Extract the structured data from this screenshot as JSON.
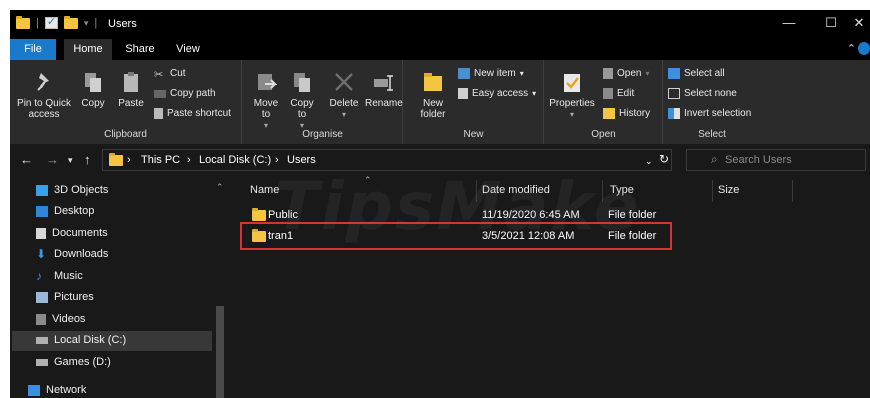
{
  "window": {
    "title": "Users",
    "min": "—",
    "max": "☐",
    "close": "✕"
  },
  "tabs": [
    "File",
    "Home",
    "Share",
    "View"
  ],
  "ribbon": {
    "clipboard": {
      "label": "Clipboard",
      "pin": "Pin to Quick access",
      "copy": "Copy",
      "paste": "Paste",
      "cut": "Cut",
      "copy_path": "Copy path",
      "paste_shortcut": "Paste shortcut"
    },
    "organise": {
      "label": "Organise",
      "move_to": "Move to",
      "copy_to": "Copy to",
      "delete": "Delete",
      "rename": "Rename"
    },
    "new": {
      "label": "New",
      "new_folder": "New folder",
      "new_item": "New item",
      "easy_access": "Easy access"
    },
    "open": {
      "label": "Open",
      "properties": "Properties",
      "open": "Open",
      "edit": "Edit",
      "history": "History"
    },
    "select": {
      "label": "Select",
      "select_all": "Select all",
      "select_none": "Select none",
      "invert_selection": "Invert selection"
    }
  },
  "address": {
    "crumbs": [
      "This PC",
      "Local Disk (C:)",
      "Users"
    ],
    "search_placeholder": "Search Users"
  },
  "sidebar": {
    "items": [
      "3D Objects",
      "Desktop",
      "Documents",
      "Downloads",
      "Music",
      "Pictures",
      "Videos",
      "Local Disk (C:)",
      "Games (D:)",
      "Network"
    ]
  },
  "columns": [
    "Name",
    "Date modified",
    "Type",
    "Size"
  ],
  "files": [
    {
      "name": "Public",
      "date": "11/19/2020 6:45 AM",
      "type": "File folder"
    },
    {
      "name": "tran1",
      "date": "3/5/2021 12:08 AM",
      "type": "File folder"
    }
  ],
  "watermark": "TipsMake",
  "colors": {
    "accent": "#1979ca",
    "highlight_border": "#d83232",
    "folder": "#f4c542"
  }
}
